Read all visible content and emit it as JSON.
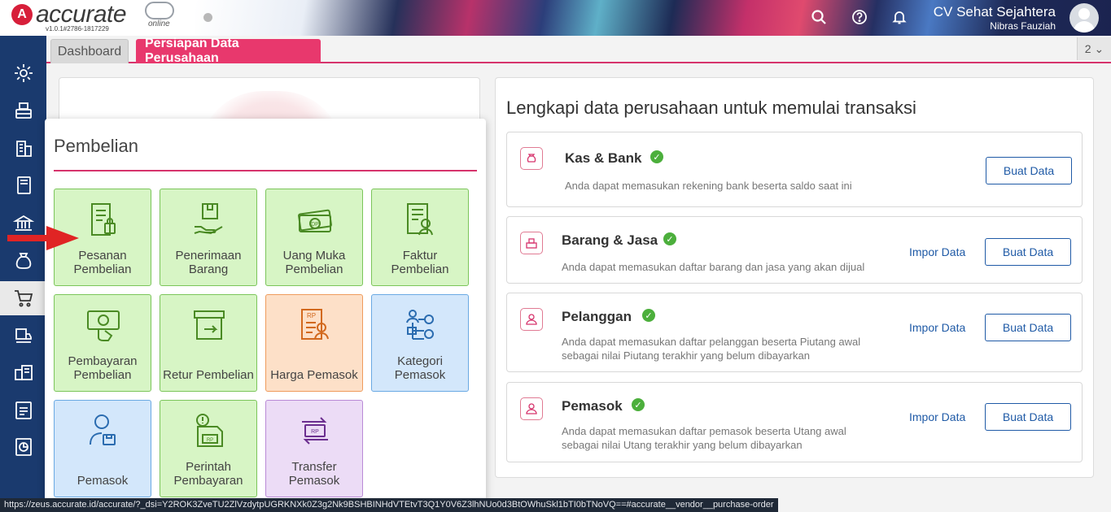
{
  "header": {
    "logo_mark": "A",
    "logo_text": "accurate",
    "logo_online": "online",
    "version": "v1.0.1#2786-1817229",
    "company_name": "CV Sehat Sejahtera",
    "user_name": "Nibras Fauziah",
    "icons": [
      "search-icon",
      "help-icon",
      "bell-icon"
    ]
  },
  "tabs": {
    "dashboard": "Dashboard",
    "active": "Persiapan Data Perusahaan",
    "count": "2 ⌄"
  },
  "sidebar": {
    "items": [
      "settings-icon",
      "cashier-icon",
      "company-icon",
      "book-icon",
      "bank-icon",
      "money-bag-icon",
      "cart-icon",
      "delivery-icon",
      "inventory-icon",
      "tax-icon",
      "report-icon"
    ],
    "active_index": 6
  },
  "popup": {
    "title": "Pembelian",
    "tiles": [
      {
        "line1": "Pesanan",
        "line2": "Pembelian",
        "color": "green",
        "icon": "purchase-order-icon"
      },
      {
        "line1": "Penerimaan",
        "line2": "Barang",
        "color": "green",
        "icon": "goods-receipt-icon"
      },
      {
        "line1": "Uang Muka",
        "line2": "Pembelian",
        "color": "green",
        "icon": "down-payment-icon"
      },
      {
        "line1": "Faktur",
        "line2": "Pembelian",
        "color": "green",
        "icon": "purchase-invoice-icon"
      },
      {
        "line1": "Pembayaran",
        "line2": "Pembelian",
        "color": "green",
        "icon": "purchase-payment-icon"
      },
      {
        "line1": "",
        "line2": "Retur Pembelian",
        "color": "green",
        "icon": "purchase-return-icon"
      },
      {
        "line1": "",
        "line2": "Harga Pemasok",
        "color": "orange",
        "icon": "vendor-price-icon"
      },
      {
        "line1": "Kategori",
        "line2": "Pemasok",
        "color": "blue",
        "icon": "vendor-category-icon"
      },
      {
        "line1": "",
        "line2": "Pemasok",
        "color": "blue",
        "icon": "vendor-icon"
      },
      {
        "line1": "Perintah",
        "line2": "Pembayaran",
        "color": "green",
        "icon": "payment-order-icon"
      },
      {
        "line1": "Transfer",
        "line2": "Pemasok",
        "color": "purple",
        "icon": "vendor-transfer-icon"
      }
    ]
  },
  "setup": {
    "title": "Lengkapi data perusahaan untuk memulai transaksi",
    "rows": [
      {
        "title": "Kas & Bank",
        "desc1": "Anda dapat memasukan rekening bank beserta saldo saat ini",
        "desc2": "",
        "impor": "",
        "buat": "Buat Data",
        "icon": "cash-bank-icon"
      },
      {
        "title": "Barang & Jasa",
        "desc1": "Anda dapat memasukan daftar barang dan jasa yang akan dijual",
        "desc2": "",
        "impor": "Impor Data",
        "buat": "Buat Data",
        "icon": "items-icon"
      },
      {
        "title": "Pelanggan",
        "desc1": "Anda dapat memasukan daftar pelanggan beserta Piutang awal",
        "desc2": "sebagai nilai Piutang terakhir yang belum dibayarkan",
        "impor": "Impor Data",
        "buat": "Buat Data",
        "icon": "customer-icon"
      },
      {
        "title": "Pemasok",
        "desc1": "Anda dapat memasukan daftar pemasok beserta Utang awal",
        "desc2": "sebagai nilai Utang terakhir yang belum dibayarkan",
        "impor": "Impor Data",
        "buat": "Buat Data",
        "icon": "vendor-icon"
      }
    ]
  },
  "status_url": "https://zeus.accurate.id/accurate/?_dsi=Y2ROK3ZveTU2ZlVzdytpUGRKNXk0Z3g2Nk9BSHBINHdVTEtvT3Q1Y0V6Z3lhNUo0d3BtOWhuSkl1bTI0bTNoVQ==#accurate__vendor__purchase-order",
  "colors": {
    "sidebar": "#1a3a6e",
    "accent": "#e8386d",
    "link": "#1f5aa6",
    "check": "#4caf3c"
  }
}
